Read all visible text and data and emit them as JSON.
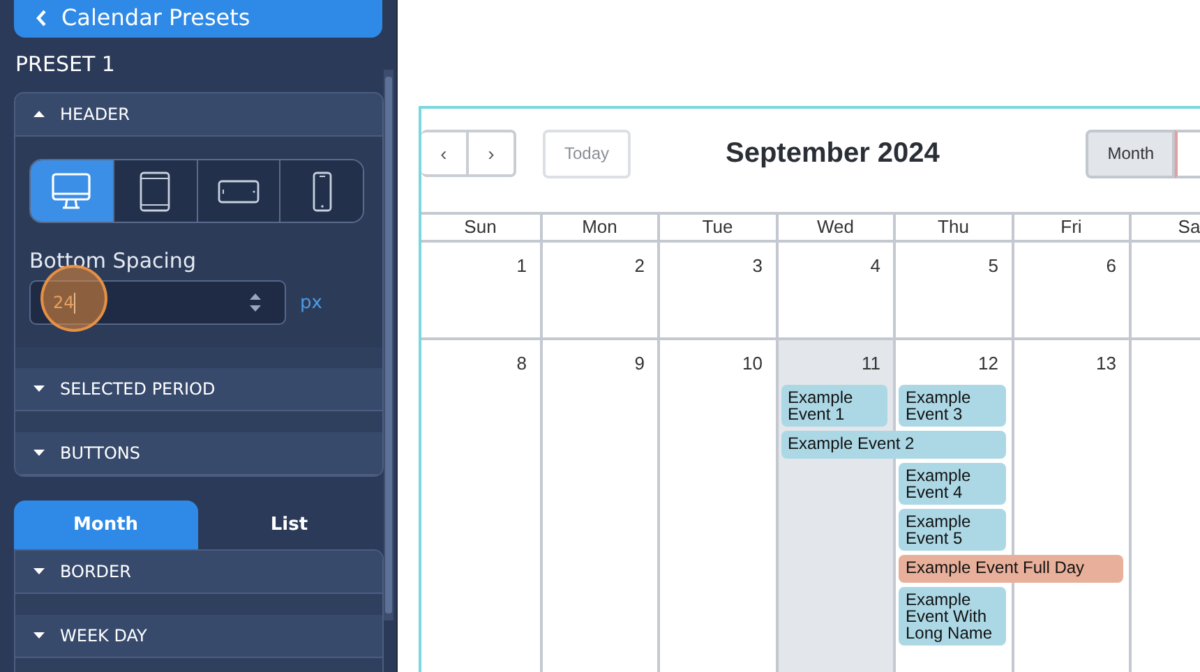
{
  "sidebar": {
    "back_button": "Calendar Presets",
    "preset_title": "PRESET 1",
    "sections": [
      {
        "title": "HEADER",
        "expanded": true,
        "devices": [
          {
            "kind": "desktop",
            "selected": true
          },
          {
            "kind": "tablet",
            "selected": false
          },
          {
            "kind": "tablet-landscape",
            "selected": false
          },
          {
            "kind": "phone",
            "selected": false
          }
        ],
        "field_label": "Bottom Spacing",
        "field_value": "24",
        "unit": "px"
      },
      {
        "title": "SELECTED PERIOD",
        "expanded": false
      },
      {
        "title": "BUTTONS",
        "expanded": false
      }
    ],
    "view_tabs": [
      {
        "label": "Month",
        "selected": true
      },
      {
        "label": "List",
        "selected": false
      }
    ],
    "view_sections": [
      {
        "title": "BORDER",
        "expanded": false
      },
      {
        "title": "WEEK DAY",
        "expanded": false
      }
    ]
  },
  "calendar": {
    "prev": "‹",
    "next": "›",
    "today_button": "Today",
    "title": "September 2024",
    "view_buttons": [
      {
        "label": "Month",
        "selected": true
      },
      {
        "selected": false
      }
    ],
    "weekdays": [
      "Sun",
      "Mon",
      "Tue",
      "Wed",
      "Thu",
      "Fri",
      "Sa"
    ],
    "weeks": [
      {
        "days": [
          {
            "number": "1",
            "today": false
          },
          {
            "number": "2",
            "today": false
          },
          {
            "number": "3",
            "today": false
          },
          {
            "number": "4",
            "today": false
          },
          {
            "number": "5",
            "today": false
          },
          {
            "number": "6",
            "today": false
          },
          {
            "today": false
          }
        ]
      },
      {
        "days": [
          {
            "number": "8",
            "today": false
          },
          {
            "number": "9",
            "today": false
          },
          {
            "number": "10",
            "today": false
          },
          {
            "number": "11",
            "today": true,
            "events": [
              {
                "title": "Example Event 1",
                "kind": "one-day",
                "color": "#acd8e6"
              },
              {
                "title": "Example Event 2",
                "kind": "two-day",
                "color": "#acd8e6"
              }
            ]
          },
          {
            "number": "12",
            "today": false,
            "events": [
              {
                "title": "Example Event 3",
                "kind": "one-day",
                "color": "#acd8e6"
              },
              {
                "title": "Example Event 4",
                "kind": "one-day",
                "color": "#acd8e6"
              },
              {
                "title": "Example Event 5",
                "kind": "one-day",
                "color": "#acd8e6"
              },
              {
                "title": "Example Event Full Day",
                "kind": "two-day",
                "color": "#e8b09a"
              },
              {
                "title": "Example Event With Long Name",
                "kind": "one-day",
                "color": "#acd8e6"
              }
            ]
          },
          {
            "number": "13",
            "today": false
          },
          {
            "today": false
          }
        ]
      }
    ]
  }
}
